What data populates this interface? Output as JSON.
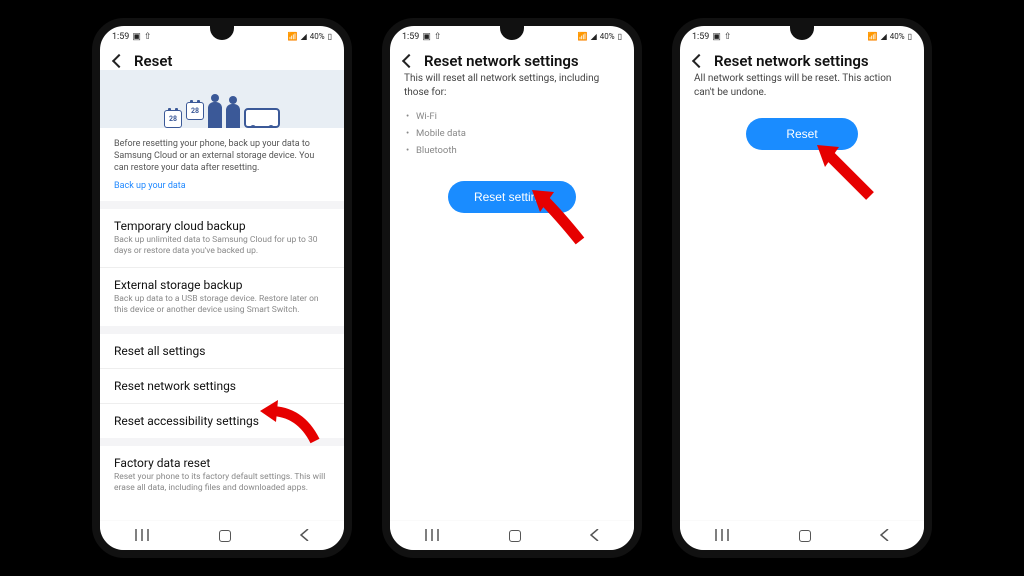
{
  "status": {
    "time": "1:59",
    "battery": "40%"
  },
  "screen1": {
    "title": "Reset",
    "banner_dates": [
      "28",
      "28"
    ],
    "info": "Before resetting your phone, back up your data to Samsung Cloud or an external storage device. You can restore your data after resetting.",
    "info_link": "Back up your data",
    "items": [
      {
        "title": "Temporary cloud backup",
        "sub": "Back up unlimited data to Samsung Cloud for up to 30 days or restore data you've backed up."
      },
      {
        "title": "External storage backup",
        "sub": "Back up data to a USB storage device. Restore later on this device or another device using Smart Switch."
      }
    ],
    "resets": [
      "Reset all settings",
      "Reset network settings",
      "Reset accessibility settings"
    ],
    "factory": {
      "title": "Factory data reset",
      "sub": "Reset your phone to its factory default settings. This will erase all data, including files and downloaded apps."
    }
  },
  "screen2": {
    "title": "Reset network settings",
    "desc": "This will reset all network settings, including those for:",
    "bullets": [
      "Wi-Fi",
      "Mobile data",
      "Bluetooth"
    ],
    "button": "Reset settings"
  },
  "screen3": {
    "title": "Reset network settings",
    "desc": "All network settings will be reset. This action can't be undone.",
    "button": "Reset"
  }
}
